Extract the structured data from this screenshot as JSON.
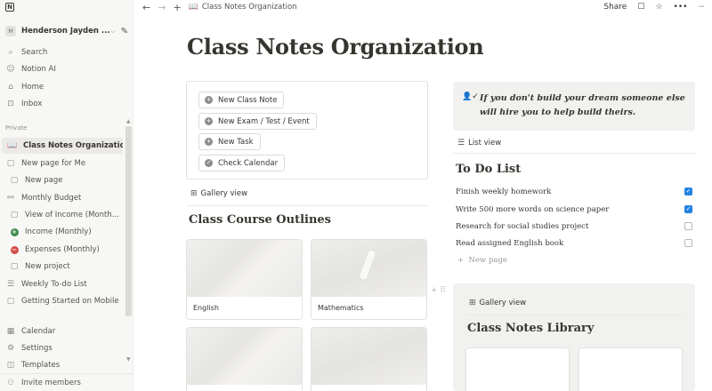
{
  "sidebar": {
    "workspace_initial": "H",
    "workspace_name": "Henderson Jayden ...",
    "top_items": [
      {
        "label": "Search"
      },
      {
        "label": "Notion AI"
      },
      {
        "label": "Home"
      },
      {
        "label": "Inbox"
      }
    ],
    "section_label": "Private",
    "pages": [
      {
        "label": "Class Notes Organization",
        "icon": "📖"
      },
      {
        "label": "New page for Me",
        "icon": "▢"
      },
      {
        "label": "New page",
        "icon": "▢"
      },
      {
        "label": "Monthly Budget",
        "icon": "⚯"
      },
      {
        "label": "View of Income (Month...",
        "icon": "▢"
      },
      {
        "label": "Income (Monthly)",
        "icon": "+"
      },
      {
        "label": "Expenses (Monthly)",
        "icon": "−"
      },
      {
        "label": "New project",
        "icon": "▢"
      },
      {
        "label": "Weekly To-do List",
        "icon": "☰"
      },
      {
        "label": "Getting Started on Mobile",
        "icon": "▢"
      }
    ],
    "bottom_items": [
      {
        "label": "Calendar"
      },
      {
        "label": "Settings"
      },
      {
        "label": "Templates"
      }
    ],
    "invite_label": "Invite members"
  },
  "topbar": {
    "breadcrumb_icon": "📖",
    "breadcrumb": "Class Notes Organization",
    "share_label": "Share",
    "more_label": "•••",
    "minimize_label": "−"
  },
  "page": {
    "title": "Class Notes Organization",
    "buttons": [
      {
        "label": "New Class Note",
        "icon": "+"
      },
      {
        "label": "New Exam / Test / Event",
        "icon": "+"
      },
      {
        "label": "New Task",
        "icon": "+"
      },
      {
        "label": "Check Calendar",
        "icon": "✓"
      }
    ],
    "gallery_view_label": "Gallery view",
    "courses_heading": "Class Course Outlines",
    "courses": [
      {
        "title": "English"
      },
      {
        "title": "Mathematics"
      }
    ],
    "quote": "If you don't build your dream someone else will hire you to help build theirs.",
    "list_view_label": "List view",
    "todo_heading": "To Do List",
    "todos": [
      {
        "label": "Finish weekly homework",
        "done": true
      },
      {
        "label": "Write 500 more words on science paper",
        "done": true
      },
      {
        "label": "Research for social studies project",
        "done": false
      },
      {
        "label": "Read assigned English book",
        "done": false
      }
    ],
    "new_page_label": "New page",
    "library_view_label": "Gallery view",
    "library_heading": "Class Notes Library"
  },
  "colors": {
    "accent_blue": "#2383e2",
    "income_green": "#3c8a4a",
    "expense_red": "#d44c47"
  }
}
